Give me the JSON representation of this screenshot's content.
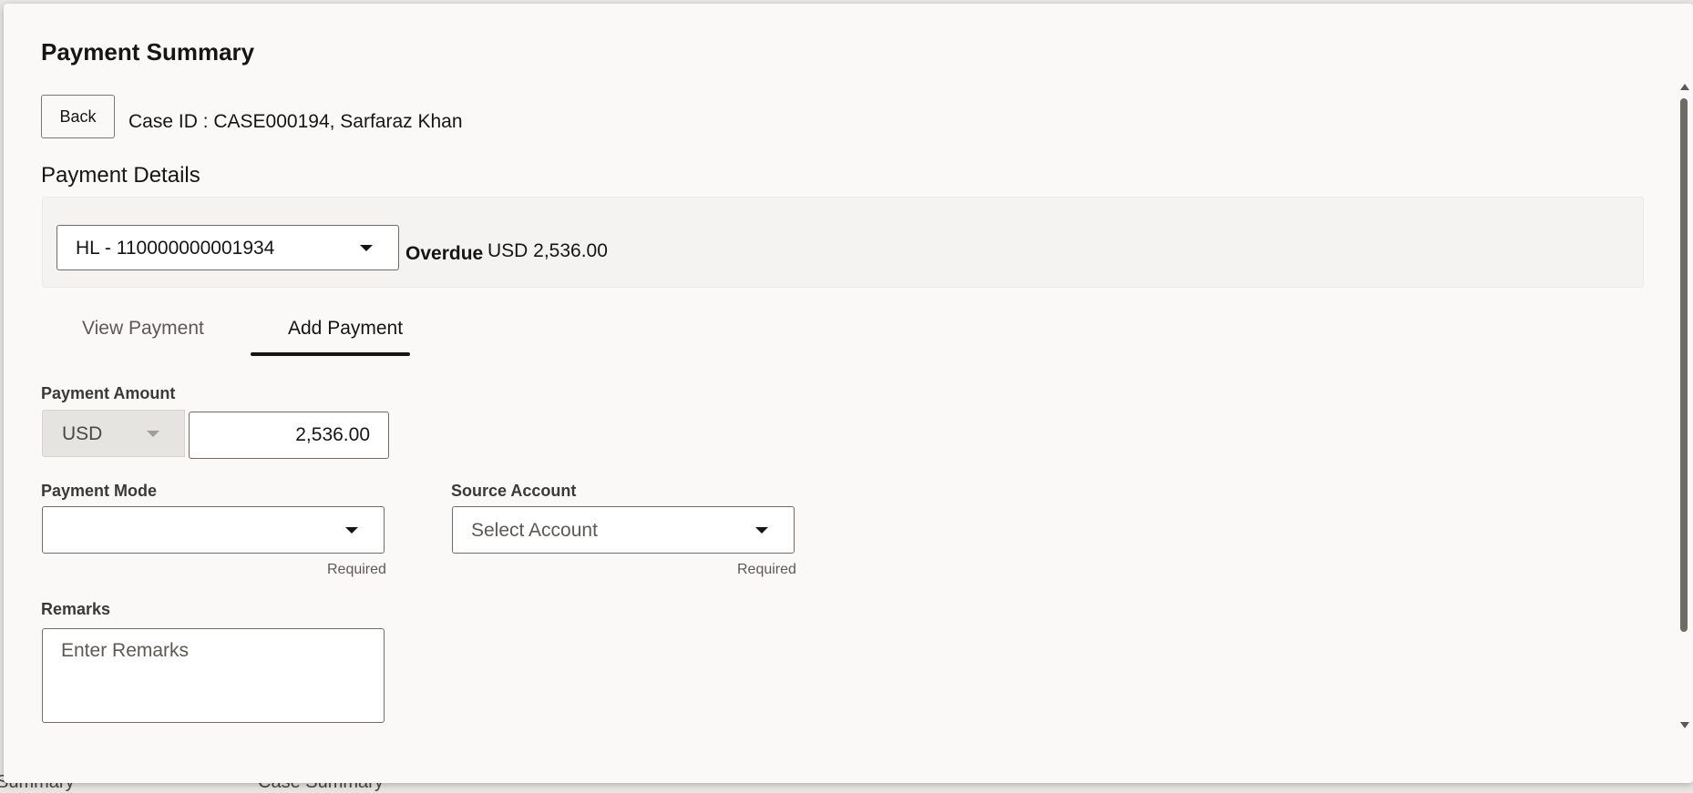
{
  "dialog": {
    "title": "Payment Summary",
    "back_label": "Back",
    "case_line": "Case ID : CASE000194, Sarfaraz Khan"
  },
  "payment_details": {
    "section_title": "Payment Details",
    "loan_account": "HL - 110000000001934",
    "overdue_label": "Overdue",
    "overdue_value": "USD 2,536.00"
  },
  "tabs": [
    {
      "label": "View Payment",
      "selected": false
    },
    {
      "label": "Add Payment",
      "selected": true
    }
  ],
  "form": {
    "payment_amount_label": "Payment Amount",
    "currency": "USD",
    "amount": "2,536.00",
    "payment_mode_label": "Payment Mode",
    "payment_mode_value": "",
    "payment_mode_hint": "Required",
    "source_account_label": "Source Account",
    "source_account_placeholder": "Select Account",
    "source_account_hint": "Required",
    "remarks_label": "Remarks",
    "remarks_placeholder": "Enter Remarks"
  },
  "background": {
    "left_text": "Summary",
    "right_text": "Case Summary"
  },
  "colors": {
    "accent": "#161513",
    "surface": "#fbf9f8",
    "panel": "#f4f3f1"
  }
}
